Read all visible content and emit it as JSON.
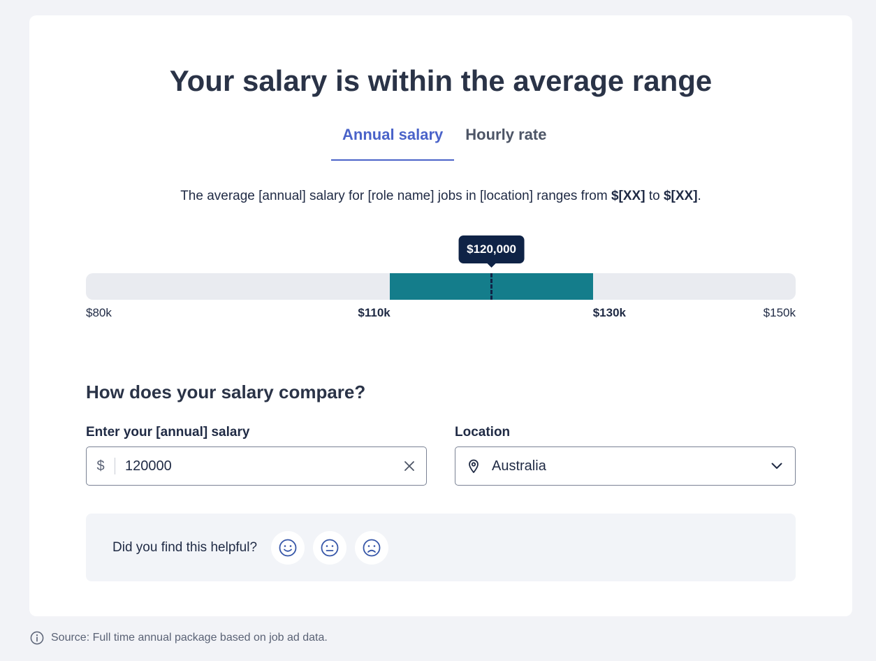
{
  "page_title": "Your salary is within the average range",
  "tabs": [
    {
      "label": "Annual salary",
      "active": true
    },
    {
      "label": "Hourly rate",
      "active": false
    }
  ],
  "description": {
    "text_before": "The average [annual] salary for [role name] jobs in [location] ranges from ",
    "low": "$[XX]",
    "text_mid": " to ",
    "high": "$[XX]",
    "text_after": "."
  },
  "range": {
    "min": 80000,
    "max": 150000,
    "band_low": 110000,
    "band_high": 130000,
    "marker_value": 120000,
    "marker_label": "$120,000",
    "ticks": [
      "$80k",
      "$110k",
      "$130k",
      "$150k"
    ]
  },
  "compare": {
    "heading": "How does your salary compare?",
    "salary_label": "Enter your [annual] salary",
    "currency_symbol": "$",
    "salary_value": "120000",
    "location_label": "Location",
    "location_value": "Australia"
  },
  "feedback": {
    "question": "Did you find this helpful?",
    "options": [
      "happy-face-icon",
      "neutral-face-icon",
      "sad-face-icon"
    ]
  },
  "source_note": "Source: Full time annual package based on job ad data.",
  "colors": {
    "accent": "#4a63c9",
    "band": "#147d8b",
    "tooltip": "#0f2346",
    "track": "#e9ebf0"
  }
}
